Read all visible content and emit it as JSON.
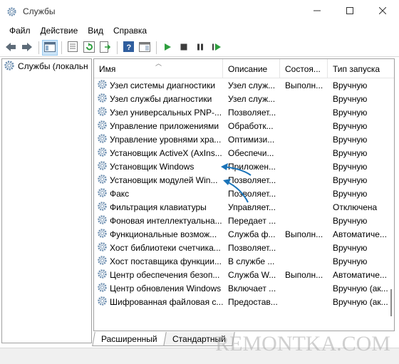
{
  "window": {
    "title": "Службы",
    "minimize_icon": "minimize-icon",
    "maximize_icon": "maximize-icon",
    "close_icon": "close-icon"
  },
  "menu": [
    "Файл",
    "Действие",
    "Вид",
    "Справка"
  ],
  "toolbar": {
    "buttons": [
      "back-arrow-icon",
      "forward-arrow-icon",
      "show-hide-tree-icon",
      "properties-icon",
      "refresh-icon",
      "export-list-icon",
      "help-icon",
      "console-view-icon",
      "start-service-icon",
      "stop-service-icon",
      "pause-service-icon",
      "restart-service-icon"
    ]
  },
  "tree": {
    "root_label": "Службы (локальн"
  },
  "columns": {
    "name": "Имя",
    "description": "Описание",
    "status": "Состоя...",
    "startup": "Тип запуска"
  },
  "services": [
    {
      "name": "Узел системы диагностики",
      "description": "Узел служ...",
      "status": "Выполн...",
      "startup": "Вручную"
    },
    {
      "name": "Узел службы диагностики",
      "description": "Узел служ...",
      "status": "",
      "startup": "Вручную"
    },
    {
      "name": "Узел универсальных PNP-...",
      "description": "Позволяет...",
      "status": "",
      "startup": "Вручную"
    },
    {
      "name": "Управление приложениями",
      "description": "Обработк...",
      "status": "",
      "startup": "Вручную"
    },
    {
      "name": "Управление уровнями хра...",
      "description": "Оптимизи...",
      "status": "",
      "startup": "Вручную"
    },
    {
      "name": "Установщик ActiveX (AxIns...",
      "description": "Обеспечи...",
      "status": "",
      "startup": "Вручную"
    },
    {
      "name": "Установщик Windows",
      "description": "Приложен...",
      "status": "",
      "startup": "Вручную"
    },
    {
      "name": "Установщик модулей Win...",
      "description": "Позволяет...",
      "status": "",
      "startup": "Вручную"
    },
    {
      "name": "Факс",
      "description": "Позволяет...",
      "status": "",
      "startup": "Вручную"
    },
    {
      "name": "Фильтрация клавиатуры",
      "description": "Управляет...",
      "status": "",
      "startup": "Отключена"
    },
    {
      "name": "Фоновая интеллектуальна...",
      "description": "Передает ...",
      "status": "",
      "startup": "Вручную"
    },
    {
      "name": "Функциональные возмож...",
      "description": "Служба ф...",
      "status": "Выполн...",
      "startup": "Автоматиче..."
    },
    {
      "name": "Хост библиотеки счетчика...",
      "description": "Позволяет...",
      "status": "",
      "startup": "Вручную"
    },
    {
      "name": "Хост поставщика функции...",
      "description": "В службе ...",
      "status": "",
      "startup": "Вручную"
    },
    {
      "name": "Центр обеспечения безоп...",
      "description": "Служба W...",
      "status": "Выполн...",
      "startup": "Автоматиче..."
    },
    {
      "name": "Центр обновления Windows",
      "description": "Включает ...",
      "status": "",
      "startup": "Вручную (ак..."
    },
    {
      "name": "Шифрованная файловая с...",
      "description": "Предостав...",
      "status": "",
      "startup": "Вручную (ак..."
    }
  ],
  "tabs": [
    "Расширенный",
    "Стандартный"
  ],
  "watermark": "REMONTKA.COM",
  "colors": {
    "annotation_arrow": "#1a73b8",
    "selection": "#cce4f7",
    "start_green": "#2e9e3e"
  }
}
